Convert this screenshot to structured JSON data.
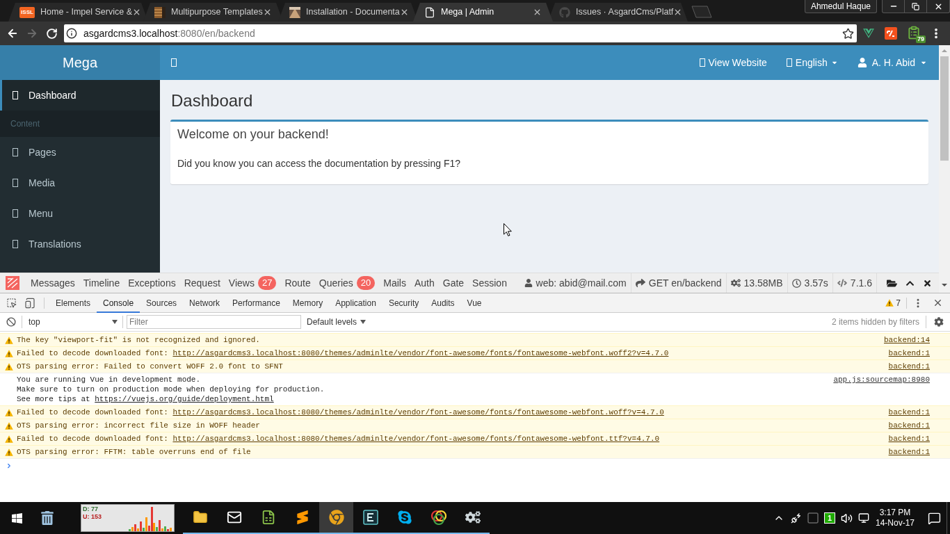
{
  "browser": {
    "tabs": [
      {
        "title": "Home - Impel Service &",
        "favicon": {
          "kind": "text",
          "text": "ISSL"
        },
        "selected": false
      },
      {
        "title": "Multipurpose Templates",
        "favicon": {
          "kind": "texture"
        },
        "selected": false
      },
      {
        "title": "Installation - Documenta",
        "favicon": {
          "kind": "photo"
        },
        "selected": false
      },
      {
        "title": "Mega | Admin",
        "favicon": {
          "kind": "page"
        },
        "selected": true
      },
      {
        "title": "Issues · AsgardCms/Platf",
        "favicon": {
          "kind": "cat"
        },
        "selected": false
      }
    ],
    "profile": "Ahmedul Haque",
    "nav_buttons": [
      {
        "kind": "back",
        "disabled": false
      },
      {
        "kind": "forward",
        "disabled": true
      },
      {
        "kind": "reload",
        "disabled": false
      }
    ],
    "address": {
      "host": "asgardcms3.localhost",
      "rest": ":8080/en/backend"
    },
    "extensions": [
      {
        "kind": "vue"
      },
      {
        "kind": "code"
      },
      {
        "kind": "clipboard",
        "badge": "79"
      }
    ]
  },
  "app": {
    "brand": "Mega",
    "header_links": [
      {
        "kind": "link",
        "label": "View Website"
      },
      {
        "kind": "menu",
        "label": "English"
      },
      {
        "kind": "user",
        "label": "A. H. Abid"
      }
    ],
    "sidebar": [
      {
        "kind": "item",
        "label": "Dashboard",
        "selected": true
      },
      {
        "kind": "header",
        "label": "Content"
      },
      {
        "kind": "item",
        "label": "Pages",
        "selected": false
      },
      {
        "kind": "item",
        "label": "Media",
        "selected": false
      },
      {
        "kind": "item",
        "label": "Menu",
        "selected": false
      },
      {
        "kind": "item",
        "label": "Translations",
        "selected": false
      }
    ],
    "page_title": "Dashboard",
    "box": {
      "title": "Welcome on your backend!",
      "body": "Did you know you can access the documentation by pressing F1?"
    }
  },
  "debugbar": {
    "tabs": [
      {
        "label": "Messages",
        "selected": false
      },
      {
        "label": "Timeline",
        "selected": false
      },
      {
        "label": "Exceptions",
        "selected": false
      },
      {
        "label": "Request",
        "selected": false
      },
      {
        "label": "Views",
        "badge": "27",
        "selected": false
      },
      {
        "label": "Route",
        "selected": false
      },
      {
        "label": "Queries",
        "badge": "20",
        "selected": false
      },
      {
        "label": "Mails",
        "selected": false
      },
      {
        "label": "Auth",
        "selected": false
      },
      {
        "label": "Gate",
        "selected": false
      },
      {
        "label": "Session",
        "selected": false
      }
    ],
    "stats": [
      {
        "kind": "user",
        "text": "web: abid@mail.com"
      },
      {
        "kind": "route",
        "text": "GET en/backend"
      },
      {
        "kind": "memory",
        "text": "13.58MB"
      },
      {
        "kind": "time",
        "text": "3.57s"
      },
      {
        "kind": "version",
        "text": "7.1.6"
      }
    ]
  },
  "devtools": {
    "tabs": [
      {
        "label": "Elements",
        "selected": false
      },
      {
        "label": "Console",
        "selected": true
      },
      {
        "label": "Sources",
        "selected": false
      },
      {
        "label": "Network",
        "selected": false
      },
      {
        "label": "Performance",
        "selected": false
      },
      {
        "label": "Memory",
        "selected": false
      },
      {
        "label": "Application",
        "selected": false
      },
      {
        "label": "Security",
        "selected": false
      },
      {
        "label": "Audits",
        "selected": false
      },
      {
        "label": "Vue",
        "selected": false
      }
    ],
    "warning_count": "7",
    "context": "top",
    "filter": {
      "placeholder": "Filter"
    },
    "levels": "Default levels",
    "hidden_note": "2 items hidden by filters",
    "messages": [
      {
        "kind": "warning",
        "lines": [
          {
            "text": "The key \"viewport-fit\" is not recognized and ignored."
          }
        ],
        "source": "backend:14"
      },
      {
        "kind": "warning",
        "lines": [
          {
            "text": "Failed to decode downloaded font:",
            "link": "http://asgardcms3.localhost:8080/themes/adminlte/vendor/font-awesome/fonts/fontawesome-webfont.woff2?v=4.7.0"
          }
        ],
        "source": "backend:1"
      },
      {
        "kind": "warning",
        "lines": [
          {
            "text": "OTS parsing error: Failed to convert WOFF 2.0 font to SFNT"
          }
        ],
        "source": "backend:1"
      },
      {
        "kind": "info",
        "lines": [
          {
            "text": "You are running Vue in development mode."
          },
          {
            "text": "Make sure to turn on production mode when deploying for production."
          },
          {
            "text": "See more tips at",
            "link": "https://vuejs.org/guide/deployment.html"
          }
        ],
        "source": "app.js:sourcemap:8980"
      },
      {
        "kind": "warning",
        "lines": [
          {
            "text": "Failed to decode downloaded font:",
            "link": "http://asgardcms3.localhost:8080/themes/adminlte/vendor/font-awesome/fonts/fontawesome-webfont.woff?v=4.7.0"
          }
        ],
        "source": "backend:1"
      },
      {
        "kind": "warning",
        "lines": [
          {
            "text": "OTS parsing error: incorrect file size in WOFF header"
          }
        ],
        "source": "backend:1"
      },
      {
        "kind": "warning",
        "lines": [
          {
            "text": "Failed to decode downloaded font:",
            "link": "http://asgardcms3.localhost:8080/themes/adminlte/vendor/font-awesome/fonts/fontawesome-webfont.ttf?v=4.7.0"
          }
        ],
        "source": "backend:1"
      },
      {
        "kind": "warning",
        "lines": [
          {
            "text": "OTS parsing error: FFTM: table overruns end of file"
          }
        ],
        "source": "backend:1"
      }
    ]
  },
  "taskbar": {
    "net_meter": {
      "download": "D: 77",
      "upload": "U: 153"
    },
    "apps": [
      {
        "kind": "explorer",
        "running": true,
        "selected": false
      },
      {
        "kind": "mail",
        "running": true,
        "selected": false
      },
      {
        "kind": "sheet",
        "running": true,
        "selected": false
      },
      {
        "kind": "sublime",
        "running": true,
        "selected": false
      },
      {
        "kind": "chrome",
        "running": true,
        "selected": true
      },
      {
        "kind": "editor",
        "running": true,
        "selected": false
      },
      {
        "kind": "skype",
        "running": true,
        "selected": false
      },
      {
        "kind": "rings",
        "running": true,
        "selected": false
      },
      {
        "kind": "gear",
        "running": true,
        "selected": false
      }
    ],
    "tray_badge": "1",
    "clock": {
      "time": "3:17 PM",
      "date": "14-Nov-17"
    }
  }
}
